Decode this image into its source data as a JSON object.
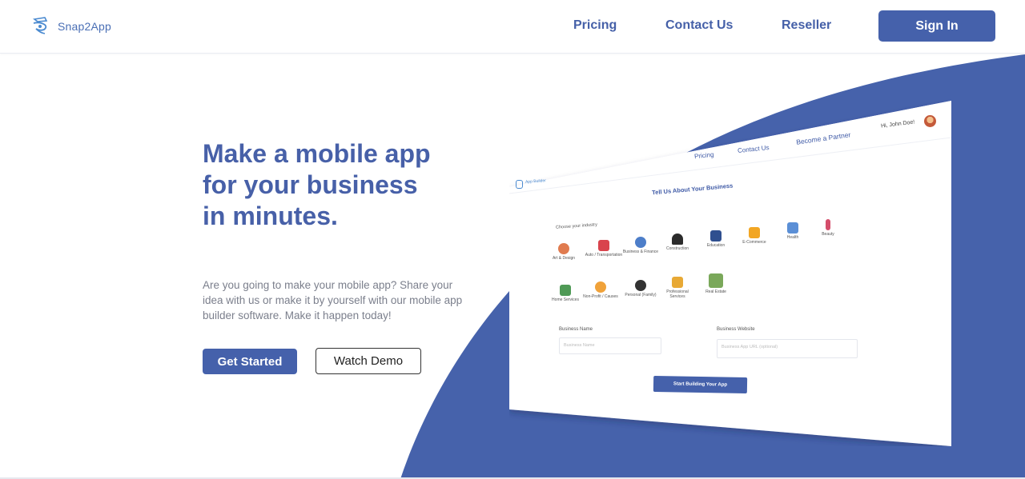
{
  "brand": {
    "name": "Snap2App",
    "accent": "#4561ab"
  },
  "nav": {
    "pricing": "Pricing",
    "contact": "Contact Us",
    "reseller": "Reseller",
    "signin": "Sign In"
  },
  "hero": {
    "title": "Make a mobile app for your business in minutes.",
    "text": "Are you going to make your mobile app? Share your idea with us or make it by yourself with our mobile app builder software. Make it happen today!",
    "get_started": "Get Started",
    "watch_demo": "Watch Demo"
  },
  "mockup": {
    "nav": {
      "pricing": "Pricing",
      "contact": "Contact Us",
      "partner": "Become a Partner",
      "greeting": "Hi, John Doe!",
      "logo_text": "App Builder"
    },
    "heading": "Tell Us About Your Business",
    "choose_label": "Choose your industry",
    "industries": [
      {
        "label": "Art & Design",
        "icon": "palette-icon",
        "color": "#e07b4f"
      },
      {
        "label": "Auto / Transportation",
        "icon": "car-icon",
        "color": "#d9444d"
      },
      {
        "label": "Business & Finance",
        "icon": "people-icon",
        "color": "#4d7ec9"
      },
      {
        "label": "Construction",
        "icon": "helmet-icon",
        "color": "#2b2b2b"
      },
      {
        "label": "Education",
        "icon": "graduation-cap-icon",
        "color": "#2f4f8f"
      },
      {
        "label": "E-Commerce",
        "icon": "cart-icon",
        "color": "#f2a623"
      },
      {
        "label": "Health",
        "icon": "hospital-icon",
        "color": "#5b8fd6"
      },
      {
        "label": "Beauty",
        "icon": "lipstick-icon",
        "color": "#d44d6b"
      },
      {
        "label": "Home Services",
        "icon": "house-icon",
        "color": "#4f9a56"
      },
      {
        "label": "Non-Profit / Causes",
        "icon": "hands-icon",
        "color": "#f0a23a"
      },
      {
        "label": "Personal (Family)",
        "icon": "person-icon",
        "color": "#333333"
      },
      {
        "label": "Professional Services",
        "icon": "drill-icon",
        "color": "#e8a935"
      },
      {
        "label": "Real Estate",
        "icon": "building-icon",
        "color": "#7aa85a"
      }
    ],
    "business_name_label": "Business Name",
    "business_name_placeholder": "Business Name",
    "business_website_label": "Business Website",
    "business_website_placeholder": "Business App URL (optional)",
    "start_button": "Start Building Your App"
  }
}
